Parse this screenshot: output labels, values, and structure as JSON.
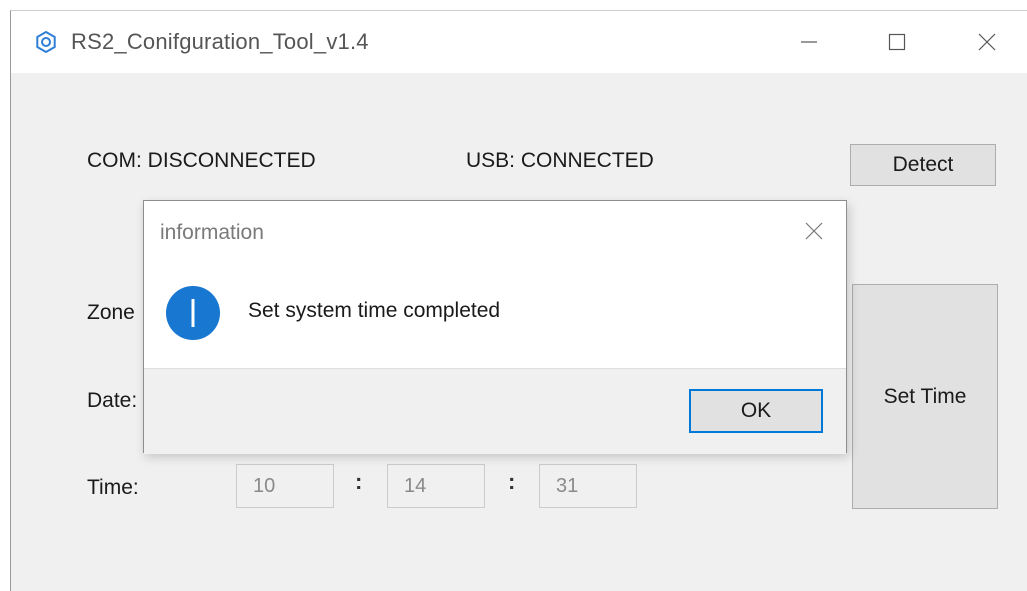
{
  "window": {
    "title": "RS2_Conifguration_Tool_v1.4"
  },
  "status": {
    "com": "COM: DISCONNECTED",
    "usb": "USB: CONNECTED"
  },
  "buttons": {
    "detect": "Detect",
    "set_time": "Set Time"
  },
  "form": {
    "zone_label": "Zone",
    "date_label": "Date:",
    "time_label": "Time:",
    "time_hour": "10",
    "time_minute": "14",
    "time_second": "31",
    "separator": ":"
  },
  "dialog": {
    "title": "information",
    "message": "Set system time completed",
    "ok_label": "OK",
    "icon": "info-icon"
  },
  "colors": {
    "accent": "#0078d7",
    "window_bg": "#f0f0f0",
    "info_icon": "#1777d1"
  },
  "icons": {
    "app": "app-icon",
    "minimize": "minimize-icon",
    "maximize": "maximize-icon",
    "close": "close-icon"
  }
}
